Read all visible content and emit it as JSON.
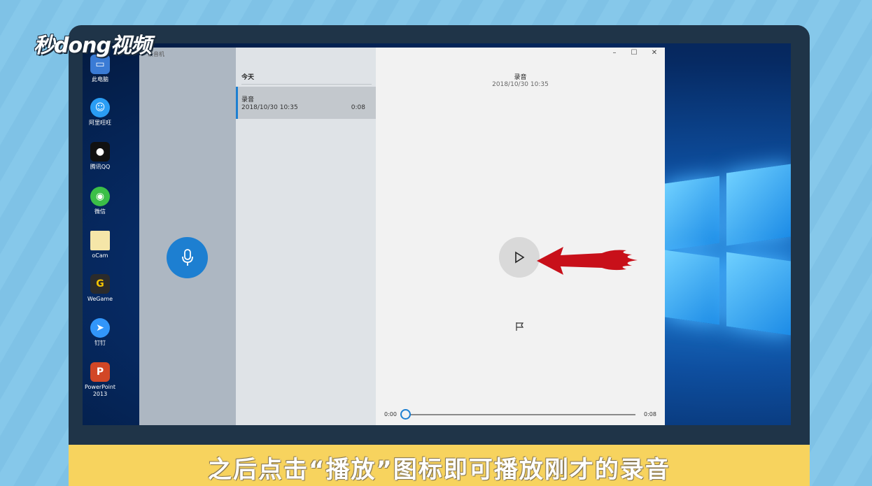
{
  "watermark": {
    "logo_text": "秒dong视频"
  },
  "desktop": {
    "icons": [
      {
        "label": "此电脑",
        "icon": "computer-icon",
        "color": "#3a7bd5"
      },
      {
        "label": "阿里旺旺",
        "icon": "aliwangwang-icon",
        "color": "#2a9df4"
      },
      {
        "label": "腾讯QQ",
        "icon": "qq-icon",
        "color": "#111111"
      },
      {
        "label": "微信",
        "icon": "wechat-icon",
        "color": "#3bbf47"
      },
      {
        "label": "oCam",
        "icon": "folder-icon",
        "color": "#f5e6a8"
      },
      {
        "label": "WeGame",
        "icon": "wegame-icon",
        "color": "#2b2b2b"
      },
      {
        "label": "钉钉",
        "icon": "dingtalk-icon",
        "color": "#3296fa"
      },
      {
        "label": "PowerPoint 2013",
        "icon": "powerpoint-icon",
        "color": "#d24726"
      }
    ]
  },
  "app": {
    "title": "录音机",
    "list": {
      "group_header": "今天",
      "items": [
        {
          "title": "录音",
          "date": "2018/10/30 10:35",
          "duration": "0:08"
        }
      ]
    },
    "player": {
      "title": "录音",
      "date": "2018/10/30 10:35",
      "time_start": "0:00",
      "time_end": "0:08",
      "progress": 0
    },
    "window_controls": {
      "minimize": "–",
      "maximize": "☐",
      "close": "✕"
    }
  },
  "caption": {
    "text": "之后点击“播放”图标即可播放刚才的录音"
  },
  "colors": {
    "accent": "#1d7fd1",
    "caption_bg": "#f7d35e",
    "arrow": "#c8101a"
  }
}
